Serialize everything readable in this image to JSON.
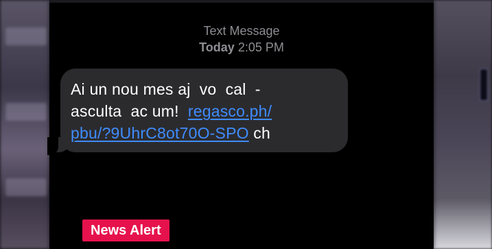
{
  "thread": {
    "header_title": "Text Message",
    "day": "Today",
    "time": "2:05 PM"
  },
  "message": {
    "line1": "Ai un nou mes aj  vo  cal  -",
    "line2_text": "asculta  ac um!  ",
    "link_part1": "regasco.ph/",
    "link_part2": "pbu/?9UhrC8ot70O-SPO",
    "line3_tail": " ch"
  },
  "overlay": {
    "news_alert": "News Alert"
  },
  "colors": {
    "link": "#3f8cff",
    "bubble": "#2b2b2e",
    "badge": "#e6124d"
  }
}
